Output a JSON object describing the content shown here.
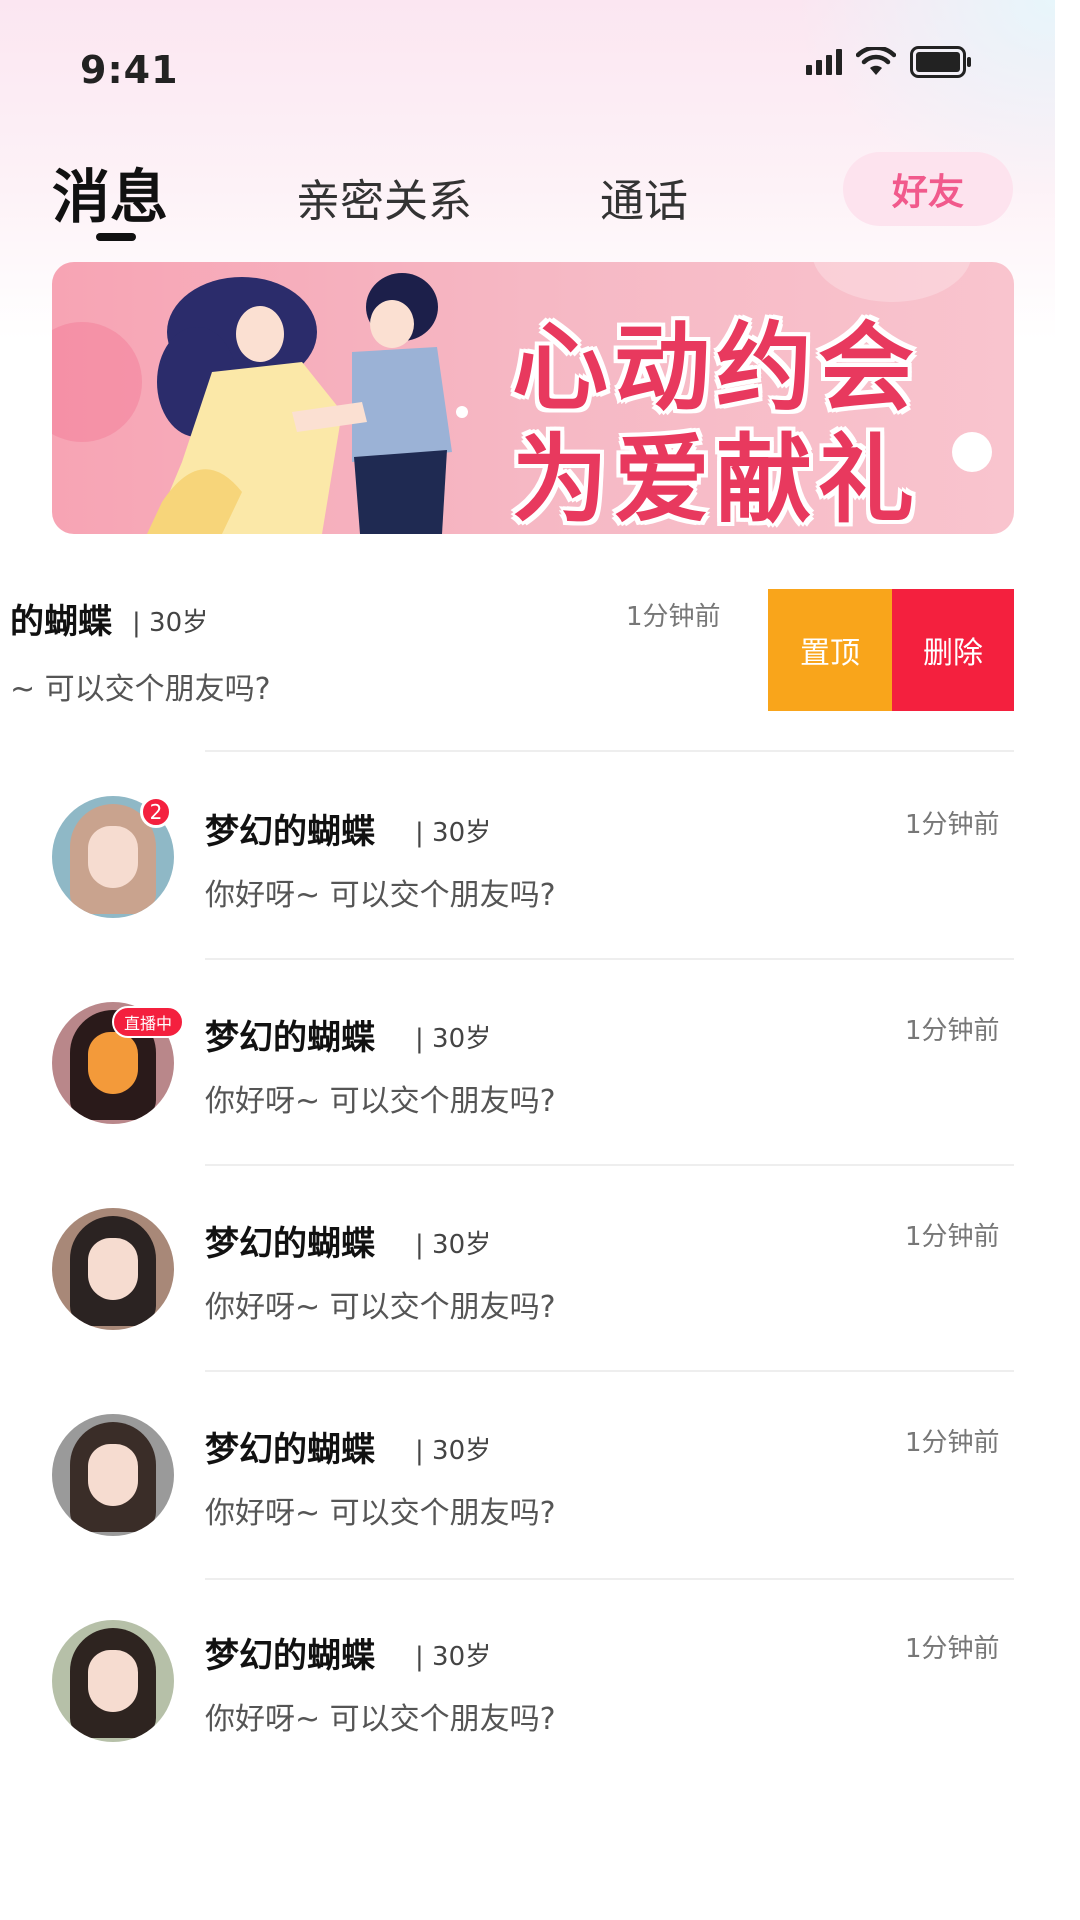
{
  "status_bar": {
    "time": "9:41"
  },
  "tabs": {
    "messages": "消息",
    "intimacy": "亲密关系",
    "calls": "通话",
    "friends": "好友"
  },
  "banner": {
    "line1": "心动约会",
    "line2": "为爱献礼"
  },
  "swiped_row": {
    "name": "的蝴蝶",
    "age": "| 30岁",
    "message": "~ 可以交个朋友吗?",
    "time": "1分钟前",
    "pin_label": "置顶",
    "delete_label": "删除"
  },
  "chats": [
    {
      "name": "梦幻的蝴蝶",
      "age": "| 30岁",
      "message": "你好呀~ 可以交个朋友吗?",
      "time": "1分钟前",
      "badge": "2",
      "avatar_color": "#8fb8c6"
    },
    {
      "name": "梦幻的蝴蝶",
      "age": "| 30岁",
      "message": "你好呀~ 可以交个朋友吗?",
      "time": "1分钟前",
      "badge": "直播中",
      "avatar_color": "#b9878a"
    },
    {
      "name": "梦幻的蝴蝶",
      "age": "| 30岁",
      "message": "你好呀~ 可以交个朋友吗?",
      "time": "1分钟前",
      "badge": "",
      "avatar_color": "#a88878"
    },
    {
      "name": "梦幻的蝴蝶",
      "age": "| 30岁",
      "message": "你好呀~ 可以交个朋友吗?",
      "time": "1分钟前",
      "badge": "",
      "avatar_color": "#9a9a9a"
    },
    {
      "name": "梦幻的蝴蝶",
      "age": "| 30岁",
      "message": "你好呀~ 可以交个朋友吗?",
      "time": "1分钟前",
      "badge": "",
      "avatar_color": "#b6c0a8"
    }
  ],
  "colors": {
    "accent_pink": "#f15a8c",
    "pin_orange": "#f9a51b",
    "delete_red": "#f4203e",
    "banner_text": "#e8395e"
  }
}
